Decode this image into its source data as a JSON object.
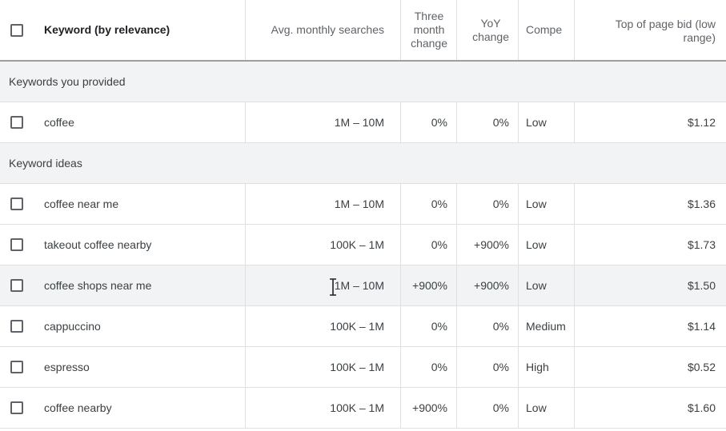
{
  "columns": {
    "keyword": "Keyword (by relevance)",
    "avg_monthly": "Avg. monthly searches",
    "three_month_l1": "Three",
    "three_month_l2": "month",
    "three_month_l3": "change",
    "yoy_l1": "YoY",
    "yoy_l2": "change",
    "competition": "Compe",
    "bid_l1": "Top of page bid (low",
    "bid_l2": "range)"
  },
  "sections": {
    "provided": "Keywords you provided",
    "ideas": "Keyword ideas"
  },
  "provided_rows": [
    {
      "keyword": "coffee",
      "avg": "1M – 10M",
      "three": "0%",
      "yoy": "0%",
      "comp": "Low",
      "bid": "$1.12"
    }
  ],
  "idea_rows": [
    {
      "keyword": "coffee near me",
      "avg": "1M – 10M",
      "three": "0%",
      "yoy": "0%",
      "comp": "Low",
      "bid": "$1.36"
    },
    {
      "keyword": "takeout coffee nearby",
      "avg": "100K – 1M",
      "three": "0%",
      "yoy": "+900%",
      "comp": "Low",
      "bid": "$1.73"
    },
    {
      "keyword": "coffee shops near me",
      "avg": "1M – 10M",
      "three": "+900%",
      "yoy": "+900%",
      "comp": "Low",
      "bid": "$1.50"
    },
    {
      "keyword": "cappuccino",
      "avg": "100K – 1M",
      "three": "0%",
      "yoy": "0%",
      "comp": "Medium",
      "bid": "$1.14"
    },
    {
      "keyword": "espresso",
      "avg": "100K – 1M",
      "three": "0%",
      "yoy": "0%",
      "comp": "High",
      "bid": "$0.52"
    },
    {
      "keyword": "coffee nearby",
      "avg": "100K – 1M",
      "three": "+900%",
      "yoy": "0%",
      "comp": "Low",
      "bid": "$1.60"
    }
  ]
}
